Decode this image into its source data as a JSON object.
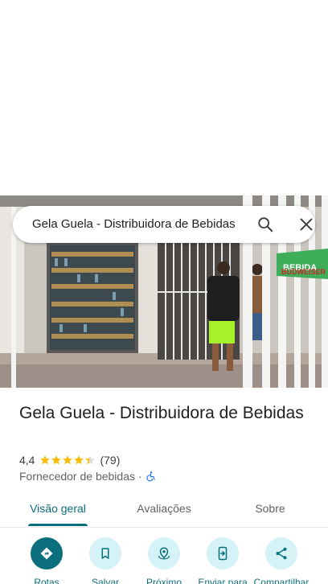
{
  "search": {
    "query": "Gela Guela - Distribuidora de Bebidas"
  },
  "place": {
    "name": "Gela Guela - Distribuidora de Bebidas",
    "rating": "4,4",
    "stars": 4.4,
    "review_count": "(79)",
    "category": "Fornecedor de bebidas",
    "separator": "·",
    "photo_sign_text": [
      "BEBIDA",
      "BUDWEISER"
    ]
  },
  "tabs": [
    {
      "label": "Visão geral",
      "active": true
    },
    {
      "label": "Avaliações",
      "active": false
    },
    {
      "label": "Sobre",
      "active": false
    }
  ],
  "actions": [
    {
      "label": "Rotas",
      "icon": "directions-icon"
    },
    {
      "label": "Salvar",
      "icon": "bookmark-icon"
    },
    {
      "label": "Próximo",
      "icon": "nearby-icon"
    },
    {
      "label": "Enviar para",
      "icon": "send-to-phone-icon"
    },
    {
      "label": "Compartilhar",
      "icon": "share-icon"
    }
  ],
  "colors": {
    "accent": "#0b6e7d",
    "accent_light": "#d5f2f6",
    "star": "#fbbc04",
    "wheelchair": "#1a73e8"
  }
}
